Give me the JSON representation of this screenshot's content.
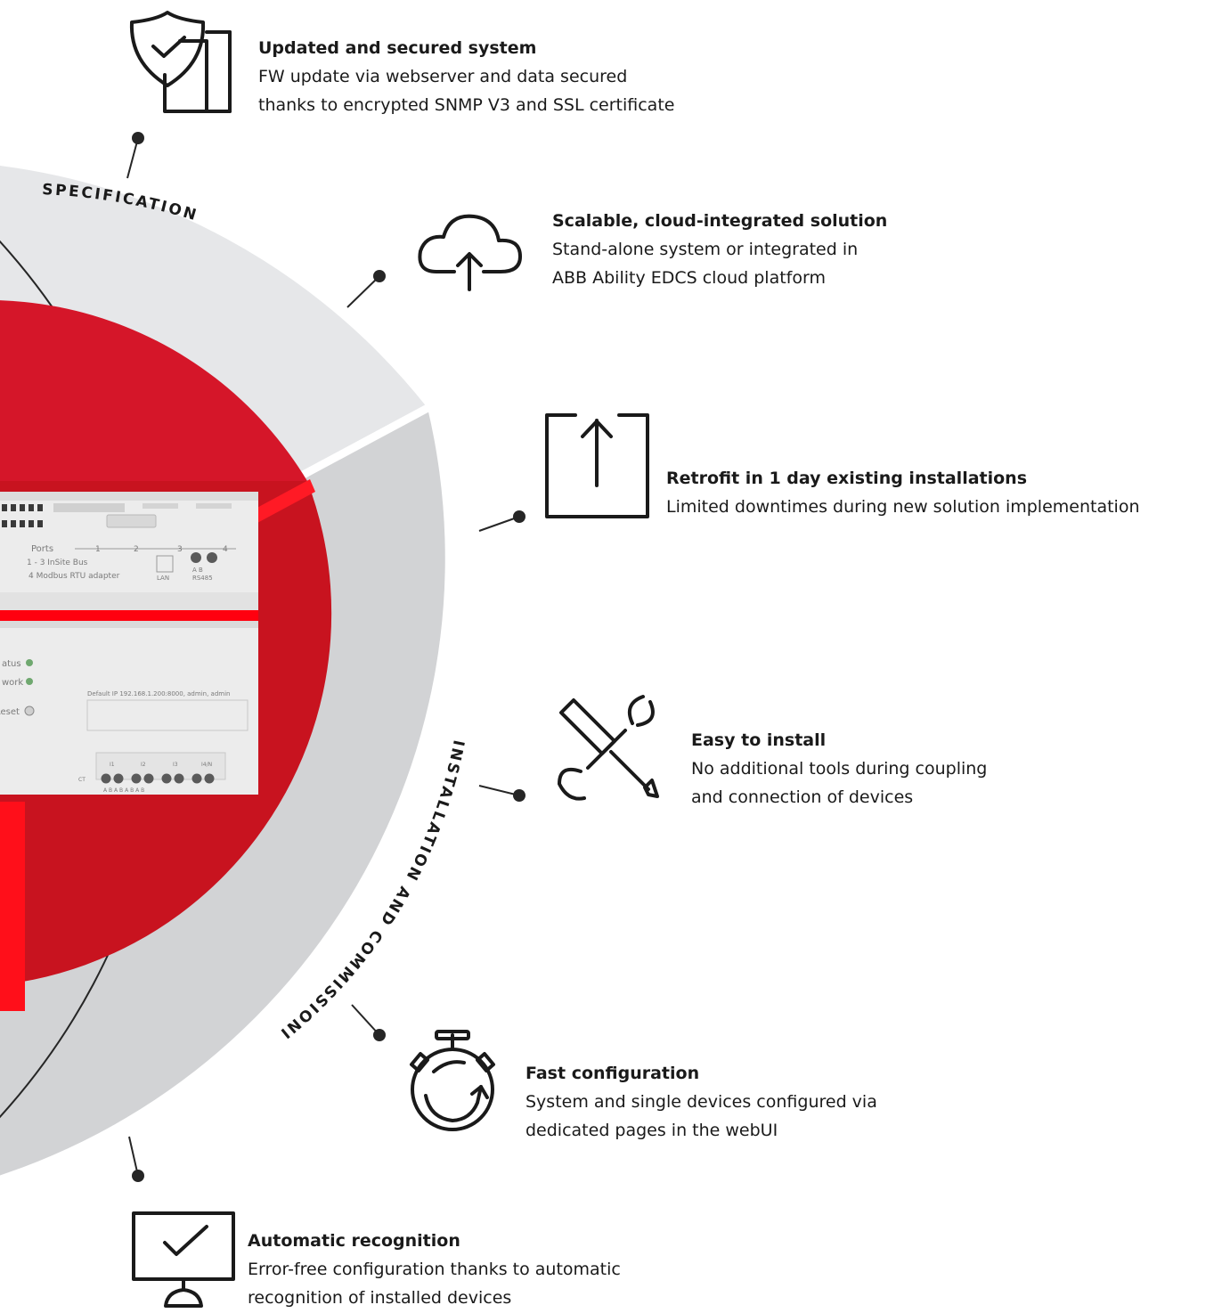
{
  "ring_labels": {
    "specification": "SPECIFICATION",
    "installation": "INSTALLATION AND COMMISSIONING"
  },
  "device": {
    "ports_label": "Ports",
    "port_numbers": [
      "1",
      "2",
      "3",
      "4"
    ],
    "port_line_1": "1 - 3  InSite Bus",
    "port_line_2": "4   Modbus RTU adapter",
    "lan_label": "LAN",
    "rs485_ab": "A    B",
    "rs485_label": "RS485",
    "status_label": "atus",
    "network_label": "work",
    "reset_label": "Reset",
    "default_ip": "Default IP 192.168.1.200:8000, admin, admin",
    "ct_label": "CT",
    "ct_channels": [
      "I1",
      "I2",
      "I3",
      "I4/N"
    ],
    "ct_terminals": "A  B  A  B  A  B  A  B"
  },
  "features": [
    {
      "icon": "shield-check-icon",
      "title": "Updated and secured system",
      "lines": [
        "FW update via webserver and data secured",
        "thanks to encrypted SNMP V3 and SSL certificate"
      ]
    },
    {
      "icon": "cloud-upload-icon",
      "title": "Scalable, cloud-integrated solution",
      "lines": [
        "Stand-alone system or integrated in",
        "ABB Ability EDCS cloud platform"
      ]
    },
    {
      "icon": "box-arrow-up-icon",
      "title": "Retrofit in 1 day existing installations",
      "lines": [
        "Limited downtimes during new solution implementation"
      ]
    },
    {
      "icon": "tools-icon",
      "title": "Easy to install",
      "lines": [
        "No additional tools during coupling",
        "and connection of devices"
      ]
    },
    {
      "icon": "stopwatch-icon",
      "title": "Fast configuration",
      "lines": [
        "System and single devices configured via",
        "dedicated pages in the webUI"
      ]
    },
    {
      "icon": "monitor-check-icon",
      "title": "Automatic recognition",
      "lines": [
        "Error-free configuration thanks to automatic",
        "recognition of installed devices"
      ]
    }
  ],
  "colors": {
    "ring_light": "#e6e7e9",
    "ring_dark": "#d2d3d5",
    "red": "#cf1323",
    "red_bright": "#ff000f",
    "device_body": "#ececec",
    "line": "#262626"
  }
}
